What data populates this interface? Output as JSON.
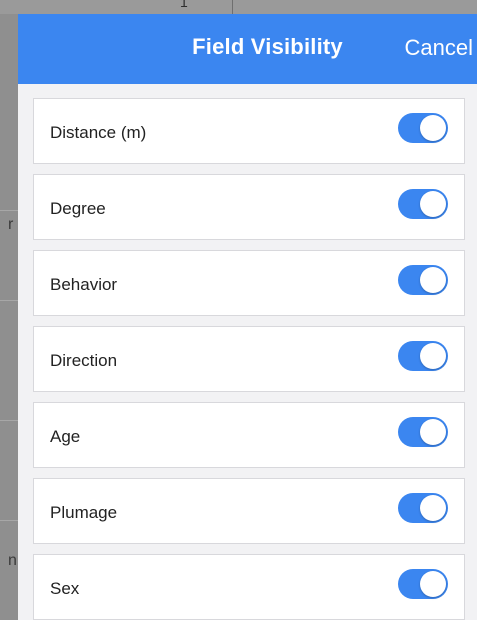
{
  "background": {
    "left_glyphs": [
      "r",
      "n"
    ],
    "top_glyph": "1"
  },
  "header": {
    "title": "Field Visibility",
    "cancel_label": "Cancel"
  },
  "fields": [
    {
      "label": "Distance (m)",
      "enabled": true
    },
    {
      "label": "Degree",
      "enabled": true
    },
    {
      "label": "Behavior",
      "enabled": true
    },
    {
      "label": "Direction",
      "enabled": true
    },
    {
      "label": "Age",
      "enabled": true
    },
    {
      "label": "Plumage",
      "enabled": true
    },
    {
      "label": "Sex",
      "enabled": true
    }
  ],
  "colors": {
    "accent": "#3b86f0",
    "toggle_off": "#e5e5ea",
    "sheet_background": "#f2f2f4",
    "backdrop": "#8f8f8f"
  }
}
